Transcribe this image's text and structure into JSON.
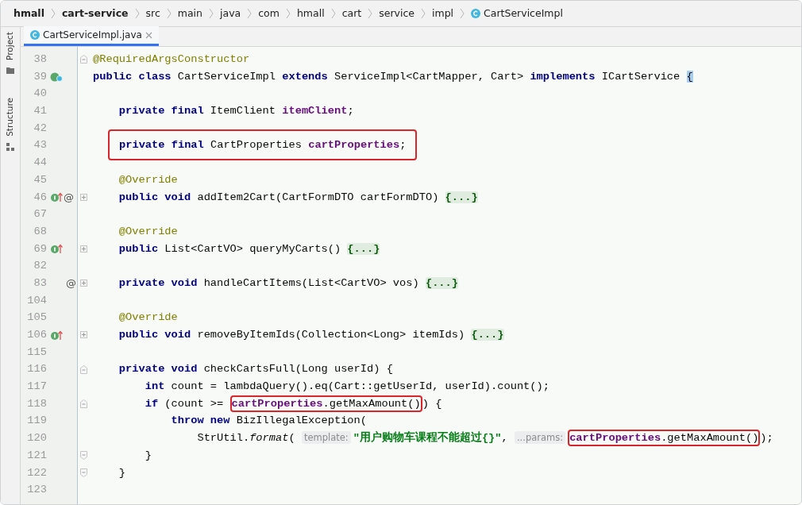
{
  "breadcrumbs": [
    {
      "text": "hmall",
      "bold": true,
      "kind": "folder"
    },
    {
      "text": "cart-service",
      "bold": true,
      "kind": "folder"
    },
    {
      "text": "src",
      "bold": false,
      "kind": "folder"
    },
    {
      "text": "main",
      "bold": false,
      "kind": "folder"
    },
    {
      "text": "java",
      "bold": false,
      "kind": "folder"
    },
    {
      "text": "com",
      "bold": false,
      "kind": "folder"
    },
    {
      "text": "hmall",
      "bold": false,
      "kind": "folder"
    },
    {
      "text": "cart",
      "bold": false,
      "kind": "folder"
    },
    {
      "text": "service",
      "bold": false,
      "kind": "folder"
    },
    {
      "text": "impl",
      "bold": false,
      "kind": "folder"
    },
    {
      "text": "CartServiceImpl",
      "bold": false,
      "kind": "class"
    }
  ],
  "tool_strip": [
    {
      "label": "Project"
    },
    {
      "label": "Structure"
    }
  ],
  "tabs": [
    {
      "label": "CartServiceImpl.java",
      "selected": true
    }
  ],
  "editor": {
    "lines": [
      {
        "number": "38",
        "kind": "fold_start",
        "tokens": [
          {
            "kind": "annotation",
            "text": "@RequiredArgsConstructor"
          }
        ]
      },
      {
        "number": "39",
        "kind": "plain",
        "gutter": [
          {
            "kind": "implemented"
          }
        ],
        "tokens": [
          {
            "kind": "keyword",
            "text": "public"
          },
          {
            "kind": "keyword",
            "text": " class"
          },
          {
            "kind": "plain",
            "text": " CartServiceImpl "
          },
          {
            "kind": "keyword",
            "text": "extends"
          },
          {
            "kind": "plain",
            "text": " ServiceImpl<CartMapper, Cart> "
          },
          {
            "kind": "keyword",
            "text": "implements"
          },
          {
            "kind": "plain",
            "text": " ICartService "
          },
          {
            "kind": "match",
            "text": "{"
          }
        ]
      },
      {
        "number": "40",
        "kind": "plain"
      },
      {
        "number": "41",
        "kind": "plain",
        "tokens": [
          {
            "kind": "keyword",
            "text": "    private"
          },
          {
            "kind": "keyword",
            "text": " final"
          },
          {
            "kind": "plain",
            "text": " ItemClient "
          },
          {
            "kind": "field",
            "text": "itemClient"
          },
          {
            "kind": "plain",
            "text": ";"
          }
        ]
      },
      {
        "number": "42",
        "kind": "plain"
      },
      {
        "number": "43",
        "kind": "plain",
        "tokens": [
          {
            "kind": "boxed",
            "wide": true,
            "tokens": [
              {
                "kind": "keyword",
                "text": "private"
              },
              {
                "kind": "keyword",
                "text": " final"
              },
              {
                "kind": "plain",
                "text": " CartProperties "
              },
              {
                "kind": "field",
                "text": "cartProperties"
              },
              {
                "kind": "plain",
                "text": ";"
              }
            ]
          }
        ]
      },
      {
        "number": "44",
        "kind": "plain"
      },
      {
        "number": "45",
        "kind": "plain",
        "tokens": [
          {
            "kind": "annotation",
            "text": "    @Override"
          }
        ]
      },
      {
        "number": "46",
        "kind": "collapsed",
        "gutter": [
          {
            "kind": "override"
          },
          {
            "kind": "symbol",
            "text": "@"
          }
        ],
        "tokens": [
          {
            "kind": "keyword",
            "text": "    public"
          },
          {
            "kind": "keyword",
            "text": " void"
          },
          {
            "kind": "plain",
            "text": " addItem2Cart(CartFormDTO cartFormDTO) "
          },
          {
            "kind": "folded",
            "text": "{...}"
          }
        ]
      },
      {
        "number": "67",
        "kind": "plain"
      },
      {
        "number": "68",
        "kind": "plain",
        "tokens": [
          {
            "kind": "annotation",
            "text": "    @Override"
          }
        ]
      },
      {
        "number": "69",
        "kind": "collapsed",
        "gutter": [
          {
            "kind": "override"
          }
        ],
        "tokens": [
          {
            "kind": "keyword",
            "text": "    public"
          },
          {
            "kind": "plain",
            "text": " List<CartVO> queryMyCarts() "
          },
          {
            "kind": "folded",
            "text": "{...}"
          }
        ]
      },
      {
        "number": "82",
        "kind": "plain"
      },
      {
        "number": "83",
        "kind": "collapsed",
        "gutter": [
          {
            "kind": "symbol",
            "text": "@"
          }
        ],
        "tokens": [
          {
            "kind": "keyword",
            "text": "    private"
          },
          {
            "kind": "keyword",
            "text": " void"
          },
          {
            "kind": "plain",
            "text": " handleCartItems(List<CartVO> vos) "
          },
          {
            "kind": "folded",
            "text": "{...}"
          }
        ]
      },
      {
        "number": "104",
        "kind": "plain"
      },
      {
        "number": "105",
        "kind": "plain",
        "tokens": [
          {
            "kind": "annotation",
            "text": "    @Override"
          }
        ]
      },
      {
        "number": "106",
        "kind": "collapsed",
        "gutter": [
          {
            "kind": "override"
          }
        ],
        "tokens": [
          {
            "kind": "keyword",
            "text": "    public"
          },
          {
            "kind": "keyword",
            "text": " void"
          },
          {
            "kind": "plain",
            "text": " removeByItemIds(Collection<Long> itemIds) "
          },
          {
            "kind": "folded",
            "text": "{...}"
          }
        ]
      },
      {
        "number": "115",
        "kind": "plain"
      },
      {
        "number": "116",
        "kind": "fold_start",
        "tokens": [
          {
            "kind": "keyword",
            "text": "    private"
          },
          {
            "kind": "keyword",
            "text": " void"
          },
          {
            "kind": "plain",
            "text": " checkCartsFull(Long userId) {"
          }
        ]
      },
      {
        "number": "117",
        "kind": "plain",
        "tokens": [
          {
            "kind": "keyword",
            "text": "        int"
          },
          {
            "kind": "plain",
            "text": " count = lambdaQuery().eq(Cart::getUserId, userId).count();"
          }
        ]
      },
      {
        "number": "118",
        "kind": "fold_start",
        "tokens": [
          {
            "kind": "keyword",
            "text": "        if"
          },
          {
            "kind": "plain",
            "text": " (count >= "
          },
          {
            "kind": "boxed",
            "wide": false,
            "tokens": [
              {
                "kind": "field",
                "text": "cartProperties"
              },
              {
                "kind": "plain",
                "text": ".getMaxAmount()"
              }
            ]
          },
          {
            "kind": "plain",
            "text": ") {"
          }
        ]
      },
      {
        "number": "119",
        "kind": "plain",
        "tokens": [
          {
            "kind": "keyword",
            "text": "            throw"
          },
          {
            "kind": "keyword",
            "text": " new"
          },
          {
            "kind": "plain",
            "text": " BizIllegalException("
          }
        ]
      },
      {
        "number": "120",
        "kind": "plain",
        "tokens": [
          {
            "kind": "plain",
            "text": "                StrUtil."
          },
          {
            "kind": "static",
            "text": "format"
          },
          {
            "kind": "plain",
            "text": "( "
          },
          {
            "kind": "hint",
            "text": "template:"
          },
          {
            "kind": "string",
            "text": "\"用户购物车课程不能超过{}\""
          },
          {
            "kind": "plain",
            "text": ", "
          },
          {
            "kind": "hint",
            "text": "...params:"
          },
          {
            "kind": "boxed",
            "wide": false,
            "tokens": [
              {
                "kind": "field",
                "text": "cartProperties"
              },
              {
                "kind": "plain",
                "text": ".getMaxAmount()"
              }
            ]
          },
          {
            "kind": "plain",
            "text": ");"
          }
        ]
      },
      {
        "number": "121",
        "kind": "fold_end",
        "tokens": [
          {
            "kind": "plain",
            "text": "        }"
          }
        ]
      },
      {
        "number": "122",
        "kind": "fold_end",
        "tokens": [
          {
            "kind": "plain",
            "text": "    }"
          }
        ]
      },
      {
        "number": "123",
        "kind": "plain"
      }
    ]
  }
}
